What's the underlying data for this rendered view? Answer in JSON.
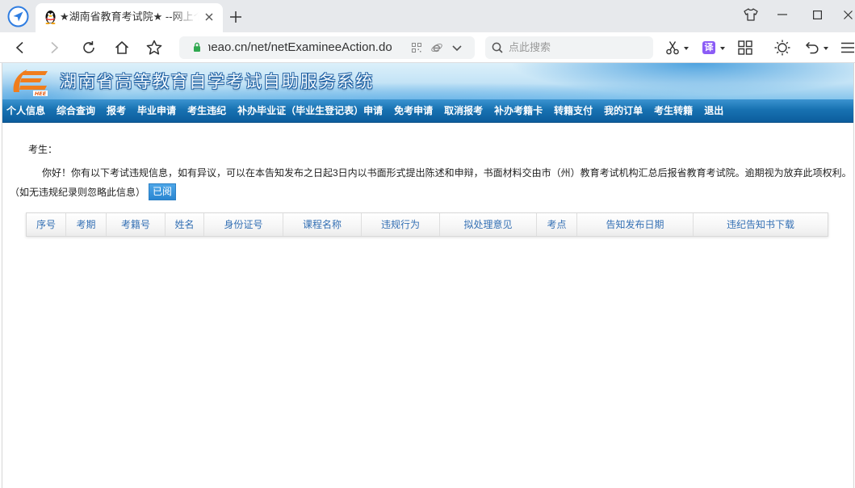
{
  "browser": {
    "tab_title": "★湖南省教育考试院★ --网上个人",
    "url": "neao.cn/net/netExamineeAction.do",
    "search_placeholder": "点此搜索",
    "translate_label": "译",
    "icons": {
      "browser_logo": "navigation-arrow-icon",
      "favicon": "penguin-icon",
      "tab_close": "close-icon",
      "new_tab": "plus-icon",
      "skin": "tshirt-icon",
      "minimize": "minimize-icon",
      "maximize": "maximize-icon",
      "close_window": "close-icon",
      "back": "chevron-left-icon",
      "forward": "chevron-right-icon",
      "reload": "reload-icon",
      "home": "home-icon",
      "bookmark": "star-icon",
      "secure": "lock-icon",
      "qr": "qr-code-icon",
      "engine": "ie-icon",
      "address_dropdown": "chevron-down-icon",
      "search": "search-icon",
      "screenshot": "scissors-icon",
      "apps": "grid-icon",
      "brightness": "sun-icon",
      "undo": "undo-icon",
      "menu": "menu-icon"
    }
  },
  "site": {
    "logo_text": "HEE",
    "title": "湖南省高等教育自学考试自助服务系统",
    "nav": [
      "个人信息",
      "综合查询",
      "报考",
      "毕业申请",
      "考生违纪",
      "补办毕业证（毕业生登记表）申请",
      "免考申请",
      "取消报考",
      "补办考籍卡",
      "转籍支付",
      "我的订单",
      "考生转籍",
      "退出"
    ]
  },
  "notice": {
    "greeting": "考生：",
    "message": "你好！你有以下考试违规信息，如有异议，可以在本告知发布之日起3日内以书面形式提出陈述和申辩，书面材料交由市（州）教育考试机构汇总后报省教育考试院。逾期视为放弃此项权利。",
    "note": "（如无违规纪录则忽略此信息）",
    "ack_button": "已阅"
  },
  "violations_table": {
    "columns": [
      "序号",
      "考期",
      "考籍号",
      "姓名",
      "身份证号",
      "课程名称",
      "违规行为",
      "拟处理意见",
      "考点",
      "告知发布日期",
      "违纪告知书下载"
    ],
    "rows": []
  },
  "colors": {
    "nav_blue": "#1872b2",
    "button_blue": "#2a86d1",
    "table_header_text": "#3470b4",
    "logo_orange": "#f07d1d",
    "secure_green": "#2fa84f",
    "translate_purple": "#8b5cf6"
  }
}
